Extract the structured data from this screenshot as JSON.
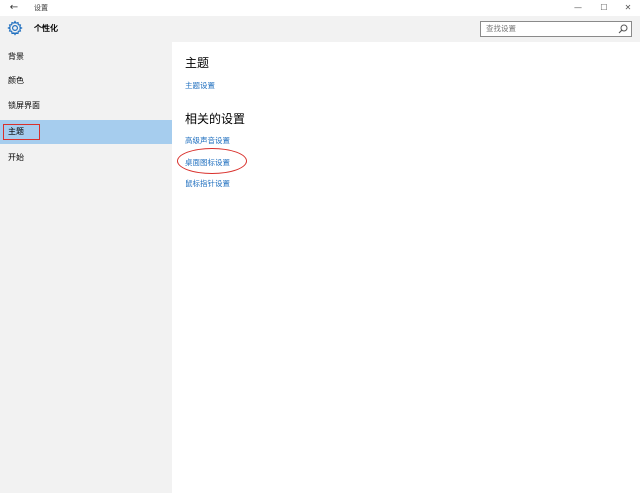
{
  "titlebar": {
    "title": "设置",
    "back_icon": "back-arrow-icon",
    "minimize": "—",
    "maximize": "☐",
    "close": "✕"
  },
  "header": {
    "title": "个性化",
    "icon": "gear-icon"
  },
  "search": {
    "placeholder": "查找设置",
    "icon": "search-icon"
  },
  "sidebar": {
    "items": [
      {
        "label": "背景"
      },
      {
        "label": "颜色"
      },
      {
        "label": "锁屏界面"
      },
      {
        "label": "主题",
        "selected": true
      },
      {
        "label": "开始"
      }
    ]
  },
  "main": {
    "section1_title": "主题",
    "section1_link": "主题设置",
    "section2_title": "相关的设置",
    "links": [
      "高级声音设置",
      "桌面图标设置",
      "鼠标指针设置"
    ]
  },
  "colors": {
    "accent": "#1f6fbf",
    "selected_bg": "#a6cdee",
    "annotation": "#d9302b"
  }
}
